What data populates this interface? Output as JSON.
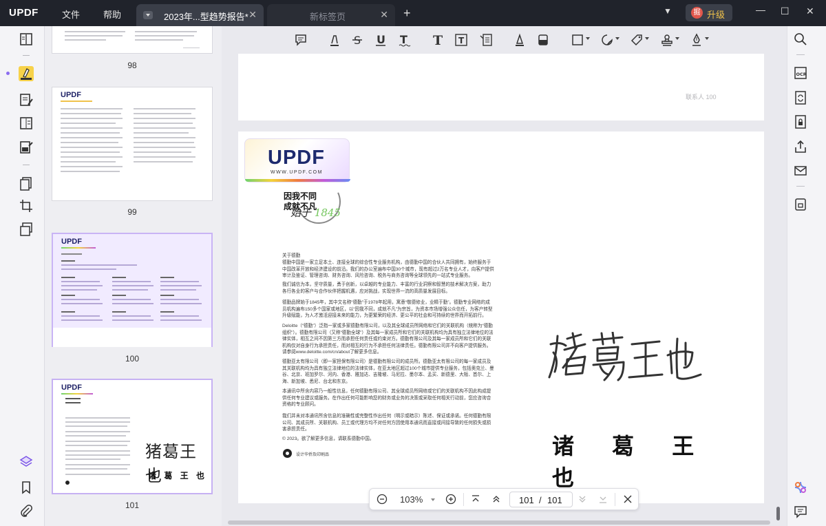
{
  "app": {
    "logo": "UPDF"
  },
  "menu": {
    "file": "文件",
    "help": "帮助"
  },
  "tabs": [
    {
      "title": "2023年...型趋势报告*"
    },
    {
      "title": "新标签页"
    }
  ],
  "upgrade": {
    "icon_char": "掘",
    "label": "升级"
  },
  "thumbnails": [
    {
      "page": "98"
    },
    {
      "page": "99",
      "logo": "UPDF"
    },
    {
      "page": "100",
      "logo": "UPDF"
    },
    {
      "page": "101",
      "logo": "UPDF",
      "sig_hand": "猪葛王也",
      "sig_print": "诸 葛 王 也"
    }
  ],
  "document": {
    "prev_page_footer": "联系人   100",
    "logo_text": "UPDF",
    "logo_url": "WWW.UPDF.COM",
    "slogan_line1": "因我不同",
    "slogan_line2": "成就不凡",
    "script_text": "始于",
    "script_year": "1845",
    "paragraphs": [
      "关于德勤",
      "德勤中国是一家立足本土、连接全球的综合性专业服务机构，由德勤中国的合伙人共同拥有，始终服务于中国改革开放和经济建设的前沿。我们的办公室遍布中国30个城市，现有超过2万名专业人才，向客户提供审计及鉴证、管理咨询、财务咨询、风险咨询、税务与商务咨询等全球领先的一站式专业服务。",
      "我们诚信为本，坚守质量，勇于创新，以卓越的专业能力、丰富的行业洞察和智慧的技术解决方案，助力各行各业的客户与合作伙伴把握机遇，应对挑战，实现世界一流的高质量发展目标。",
      "德勤品牌始于1845年，其中文名称“德勤”于1978年起用，寓意“敬德修业，业精于勤”。德勤专业网络的成员机构遍布150多个国家或地区，以“因我不同，成就不凡”为宗旨，为资本市场增强公众信任，为客户转型升级赋能，为人才激活迎接未来的能力，为更繁荣的经济、更公平的社会和可持续的世界而开拓前行。",
      "Deloitte（“德勤”）泛指一家或多家德勤有限公司，以及其全球成员所网络和它们的关联机构（统称为“德勤组织”）。德勤有限公司（又称“德勤全球”）及其每一家成员所和它们的关联机构均为具有独立法律地位的法律实体，相互之间不因第三方而承担任何责任或约束对方。德勤有限公司及其每一家成员所和它们的关联机构仅对自身行为承担责任，而对相互的行为不承担任何法律责任。德勤有限公司并不向客户提供服务。请参阅www.deloitte.com/cn/about了解更多信息。",
      "德勤亚太有限公司（即一家担保有限公司）是德勤有限公司的成员所。德勤亚太有限公司的每一家成员及其关联机构均为具有独立法律地位的法律实体，在亚太地区超过100个城市提供专业服务，包括奥克兰、曼谷、北京、班加罗尔、河内、香港、雅加达、吉隆坡、马尼拉、墨尔本、孟买、新德里、大阪、首尔、上海、新加坡、悉尼、台北和东京。",
      "本通讯中所含内容乃一般性信息，任何德勤有限公司、其全球成员所网络或它们的关联机构不因此构成提供任何专业建议或服务。在作出任何可能影响您的财务或业务的决策或采取任何相关行动前，您应咨询合资格的专业顾问。",
      "我们并未对本通讯所含信息的准确性或完整性作出任何（明示或暗示）陈述、保证或承诺。任何德勤有限公司、其成员所、关联机构、员工或代理方均不对任何方因使用本通讯而直接或间接导致的任何损失或损害承担责任。",
      "© 2023。欲了解更多信息，请联系德勤中国。"
    ],
    "footer_label": "设计华侨及印刷品",
    "signature_print": "诸 葛 王 也"
  },
  "pagenav": {
    "zoom": "103%",
    "current_page": "101",
    "separator": "/",
    "total_pages": "101"
  }
}
